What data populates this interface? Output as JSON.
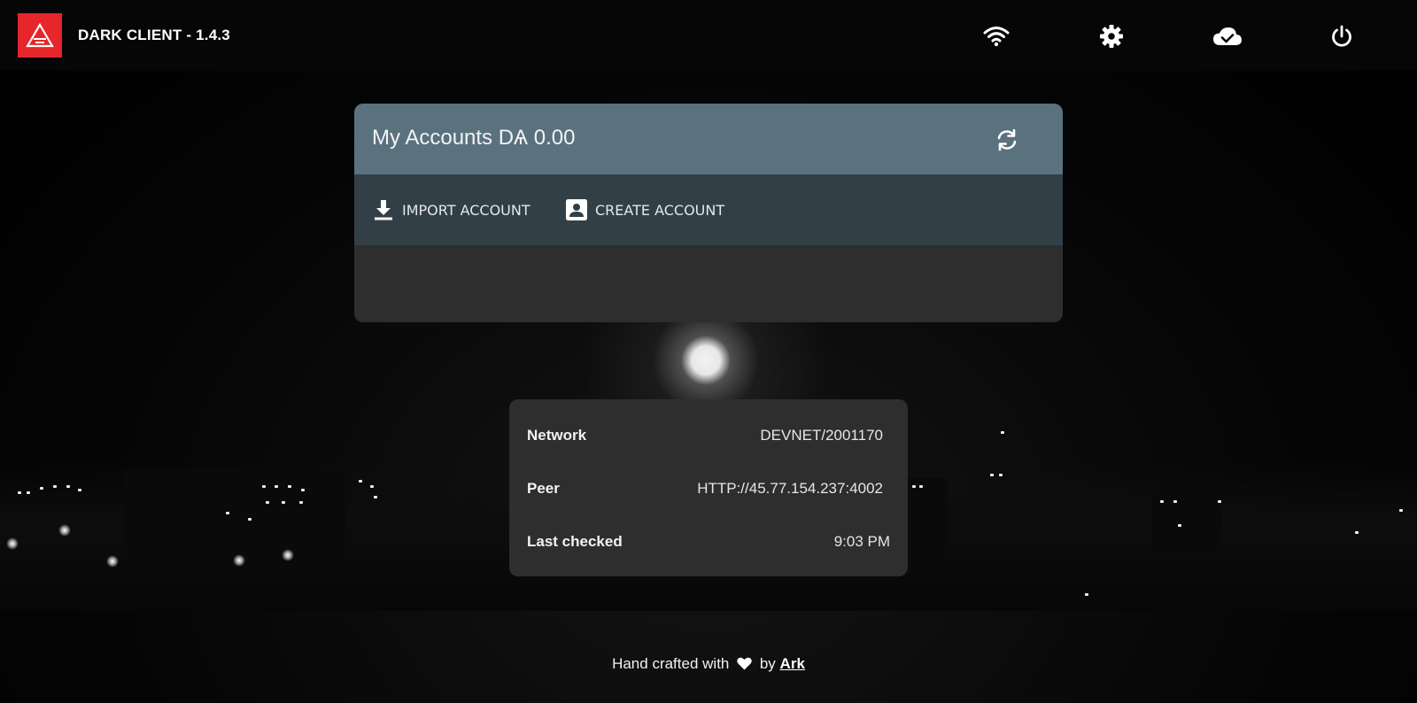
{
  "app": {
    "title": "DARK CLIENT - 1.4.3",
    "brand_color": "#e5262a"
  },
  "toolbar": {
    "icons": [
      "wifi-icon",
      "gear-icon",
      "cloud-check-icon",
      "power-icon"
    ]
  },
  "accounts": {
    "title": "My Accounts DѦ 0.00",
    "header_color": "#5a717e",
    "actions_color": "#323f47",
    "import_label": "IMPORT ACCOUNT",
    "create_label": "CREATE ACCOUNT"
  },
  "network": {
    "rows": [
      {
        "label": "Network",
        "value": "DEVNET/2001170"
      },
      {
        "label": "Peer",
        "value": "HTTP://45.77.154.237:4002"
      },
      {
        "label": "Last checked",
        "value": "9:03 PM"
      }
    ]
  },
  "footer": {
    "prefix": "Hand crafted with",
    "by": "by",
    "link": "Ark"
  }
}
